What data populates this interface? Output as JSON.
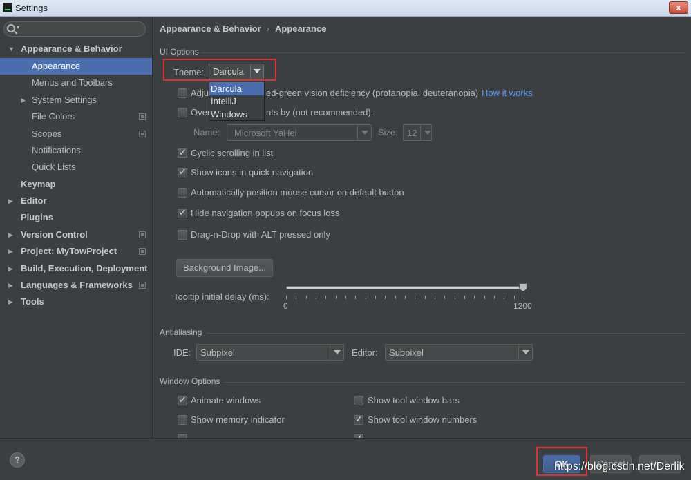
{
  "window": {
    "title": "Settings",
    "close_glyph": "x"
  },
  "search": {
    "placeholder": "",
    "caret": "▾"
  },
  "sidebar": {
    "items": [
      {
        "label": "Appearance & Behavior",
        "expanded": true
      },
      {
        "label": "Appearance"
      },
      {
        "label": "Menus and Toolbars"
      },
      {
        "label": "System Settings"
      },
      {
        "label": "File Colors"
      },
      {
        "label": "Scopes"
      },
      {
        "label": "Notifications"
      },
      {
        "label": "Quick Lists"
      },
      {
        "label": "Keymap"
      },
      {
        "label": "Editor"
      },
      {
        "label": "Plugins"
      },
      {
        "label": "Version Control"
      },
      {
        "label": "Project: MyTowProject"
      },
      {
        "label": "Build, Execution, Deployment"
      },
      {
        "label": "Languages & Frameworks"
      },
      {
        "label": "Tools"
      }
    ],
    "arrow_expanded": "▼",
    "arrow_collapsed": "▶"
  },
  "breadcrumb": {
    "parent": "Appearance & Behavior",
    "separator": "›",
    "current": "Appearance"
  },
  "ui_options": {
    "section_title": "UI Options",
    "theme_label": "Theme:",
    "theme_value": "Darcula",
    "theme_options": [
      "Darcula",
      "IntelliJ",
      "Windows"
    ],
    "adjust_colors_label": "Adjust colors for red-green vision deficiency (protanopia, deuteranopia)",
    "adjust_colors_visible_prefix": "Adju",
    "adjust_colors_visible_suffix": "ed-green vision deficiency (protanopia, deuteranopia)",
    "adjust_colors_checked": false,
    "how_it_works": "How it works",
    "override_fonts_visible_prefix": "Over",
    "override_fonts_visible_suffix": "nts by (not recommended):",
    "override_fonts_checked": false,
    "name_label": "Name:",
    "font_name": "Microsoft YaHei",
    "size_label": "Size:",
    "font_size": "12",
    "cyclic_scrolling": {
      "label": "Cyclic scrolling in list",
      "checked": true
    },
    "show_icons": {
      "label": "Show icons in quick navigation",
      "checked": true
    },
    "auto_mouse": {
      "label": "Automatically position mouse cursor on default button",
      "checked": false
    },
    "hide_nav": {
      "label": "Hide navigation popups on focus loss",
      "checked": true
    },
    "drag_drop": {
      "label": "Drag-n-Drop with ALT pressed only",
      "checked": false
    },
    "background_image_button": "Background Image...",
    "tooltip_label": "Tooltip initial delay (ms):",
    "tooltip_min": "0",
    "tooltip_max": "1200",
    "tooltip_value": 1200
  },
  "antialiasing": {
    "section_title": "Antialiasing",
    "ide_label": "IDE:",
    "ide_value": "Subpixel",
    "editor_label": "Editor:",
    "editor_value": "Subpixel"
  },
  "window_options": {
    "section_title": "Window Options",
    "animate_windows": {
      "label": "Animate windows",
      "checked": true
    },
    "show_tool_window_bars": {
      "label": "Show tool window bars",
      "checked": false
    },
    "show_memory_indicator": {
      "label": "Show memory indicator",
      "checked": false
    },
    "show_tool_window_numbers": {
      "label": "Show tool window numbers",
      "checked": true
    }
  },
  "footer": {
    "help": "?",
    "ok": "OK",
    "cancel": "Cancel",
    "apply": "Apply",
    "watermark": "https://blog.csdn.net/Derlik"
  },
  "colors": {
    "accent": "#4b6eaf",
    "link": "#589df6",
    "highlight_box": "#e03030"
  }
}
